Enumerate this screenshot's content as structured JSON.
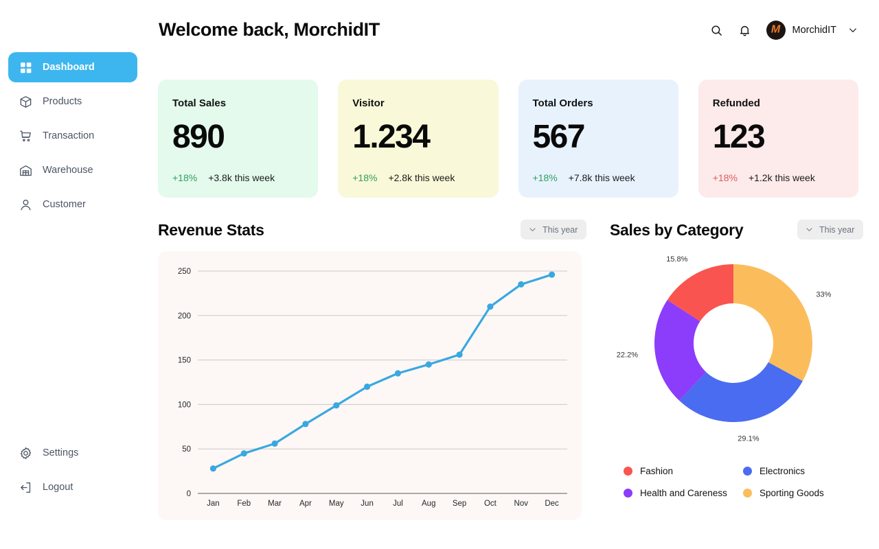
{
  "header": {
    "title": "Welcome back, MorchidIT",
    "search_icon": "search-icon",
    "bell_icon": "bell-icon",
    "profile_name": "MorchidIT",
    "avatar_monogram": "M",
    "caret_icon": "chevron-down-icon"
  },
  "sidebar": {
    "items": [
      {
        "label": "Dashboard",
        "icon": "grid-icon",
        "active": true
      },
      {
        "label": "Products",
        "icon": "box-icon",
        "active": false
      },
      {
        "label": "Transaction",
        "icon": "cart-icon",
        "active": false
      },
      {
        "label": "Warehouse",
        "icon": "warehouse-icon",
        "active": false
      },
      {
        "label": "Customer",
        "icon": "user-icon",
        "active": false
      }
    ],
    "bottom_items": [
      {
        "label": "Settings",
        "icon": "gear-icon"
      },
      {
        "label": "Logout",
        "icon": "logout-icon"
      }
    ],
    "active_color": "#3db6ef"
  },
  "stats": [
    {
      "title": "Total Sales",
      "value": "890",
      "delta": "+18%",
      "sub": "+3.8k this week",
      "bg": "#e3faec",
      "delta_color": "#2f9e5f"
    },
    {
      "title": "Visitor",
      "value": "1.234",
      "delta": "+18%",
      "sub": "+2.8k this week",
      "bg": "#f9f8d8",
      "delta_color": "#2f9e5f"
    },
    {
      "title": "Total Orders",
      "value": "567",
      "delta": "+18%",
      "sub": "+7.8k this week",
      "bg": "#e8f2fd",
      "delta_color": "#2f9e5f"
    },
    {
      "title": "Refunded",
      "value": "123",
      "delta": "+18%",
      "sub": "+1.2k this week",
      "bg": "#fdeaea",
      "delta_color": "#e05c5c"
    }
  ],
  "revenue": {
    "heading": "Revenue Stats",
    "filter_label": "This year",
    "filter_icon": "chevron-down-icon"
  },
  "category": {
    "heading": "Sales by Category",
    "filter_label": "This year",
    "filter_icon": "chevron-down-icon"
  },
  "chart_data": [
    {
      "type": "line",
      "title": "Revenue Stats",
      "xlabel": "",
      "ylabel": "",
      "categories": [
        "Jan",
        "Feb",
        "Mar",
        "Apr",
        "May",
        "Jun",
        "Jul",
        "Aug",
        "Sep",
        "Oct",
        "Nov",
        "Dec"
      ],
      "values": [
        28,
        45,
        56,
        78,
        99,
        120,
        135,
        145,
        156,
        210,
        235,
        246
      ],
      "ylim": [
        0,
        250
      ],
      "yticks": [
        0,
        50,
        100,
        150,
        200,
        250
      ],
      "grid": true,
      "legend": "none",
      "line_color": "#3aa8e0",
      "marker_color": "#3aa8e0",
      "panel_bg": "#fdf8f6"
    },
    {
      "type": "pie",
      "title": "Sales by Category",
      "donut": true,
      "labels": [
        "Sporting Goods",
        "Electronics",
        "Health and Careness",
        "Fashion"
      ],
      "values": [
        33,
        29.1,
        22.2,
        15.8
      ],
      "value_labels": [
        "33%",
        "29.1%",
        "22.2%",
        "15.8%"
      ],
      "colors": [
        "#fbbd5c",
        "#4a6cf0",
        "#8b3dfb",
        "#f9544f"
      ],
      "legend": "bottom",
      "legend_entries": [
        {
          "label": "Fashion",
          "color": "#f9544f"
        },
        {
          "label": "Electronics",
          "color": "#4a6cf0"
        },
        {
          "label": "Health and Careness",
          "color": "#8b3dfb"
        },
        {
          "label": "Sporting Goods",
          "color": "#fbbd5c"
        }
      ]
    }
  ]
}
